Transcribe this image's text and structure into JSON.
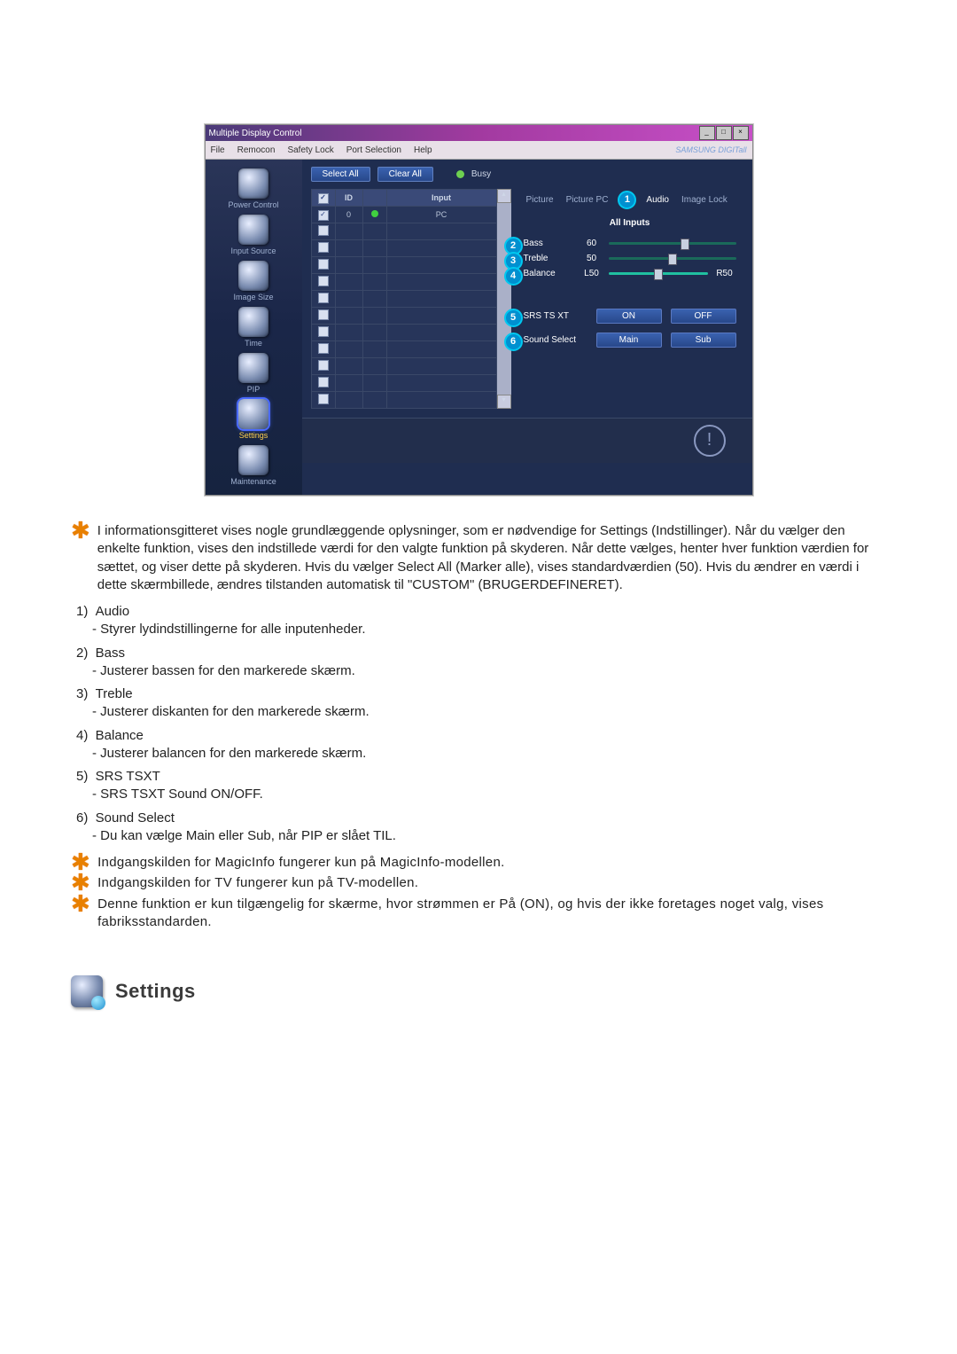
{
  "app": {
    "title": "Multiple Display Control",
    "menus": [
      "File",
      "Remocon",
      "Safety Lock",
      "Port Selection",
      "Help"
    ],
    "brand": "SAMSUNG DIGITall"
  },
  "sidebar": [
    {
      "label": "Power Control"
    },
    {
      "label": "Input Source"
    },
    {
      "label": "Image Size"
    },
    {
      "label": "Time"
    },
    {
      "label": "PIP"
    },
    {
      "label": "Settings",
      "selected": true
    },
    {
      "label": "Maintenance"
    }
  ],
  "toolbar": {
    "selectAll": "Select All",
    "clearAll": "Clear All",
    "busy": "Busy"
  },
  "grid": {
    "headers": [
      "",
      "ID",
      "",
      "Input"
    ],
    "rows": [
      {
        "checked": true,
        "id": "0",
        "status": true,
        "input": "PC"
      },
      {
        "checked": false
      },
      {
        "checked": false
      },
      {
        "checked": false
      },
      {
        "checked": false
      },
      {
        "checked": false
      },
      {
        "checked": false
      },
      {
        "checked": false
      },
      {
        "checked": false
      },
      {
        "checked": false
      },
      {
        "checked": false
      },
      {
        "checked": false
      }
    ]
  },
  "tabs": [
    "Picture",
    "Picture PC",
    "Audio",
    "Image Lock"
  ],
  "tabs_active": 2,
  "panel": {
    "subheader": "All Inputs",
    "bass": {
      "label": "Bass",
      "value": "60",
      "pct": 60
    },
    "treble": {
      "label": "Treble",
      "value": "50",
      "pct": 50
    },
    "balance": {
      "label": "Balance",
      "left": "L50",
      "right": "R50",
      "pct": 50
    },
    "srs": {
      "label": "SRS TS XT",
      "on": "ON",
      "off": "OFF"
    },
    "sound": {
      "label": "Sound Select",
      "main": "Main",
      "sub": "Sub"
    }
  },
  "doc": {
    "para1": "I informationsgitteret vises nogle grundlæggende oplysninger, som er nødvendige for Settings (Indstillinger). Når du vælger den enkelte funktion, vises den indstillede værdi for den valgte funktion på skyderen. Når dette vælges, henter hver funktion værdien for sættet, og viser dette på skyderen. Hvis du vælger Select All (Marker alle), vises standardværdien (50). Hvis du ændrer en værdi i dette skærmbillede, ændres tilstanden automatisk til \"CUSTOM\" (BRUGERDEFINERET).",
    "items": [
      {
        "t": "Audio",
        "d": "- Styrer lydindstillingerne for alle inputenheder."
      },
      {
        "t": "Bass",
        "d": "- Justerer bassen for den markerede skærm."
      },
      {
        "t": "Treble",
        "d": "- Justerer diskanten for den markerede skærm."
      },
      {
        "t": "Balance",
        "d": "- Justerer balancen for den markerede skærm."
      },
      {
        "t": "SRS TSXT",
        "d": "- SRS TSXT Sound ON/OFF."
      },
      {
        "t": "Sound Select",
        "d": "- Du kan vælge Main eller Sub, når PIP er slået TIL."
      }
    ],
    "note1": "Indgangskilden for MagicInfo fungerer kun på MagicInfo-modellen.",
    "note2": "Indgangskilden for TV fungerer kun på TV-modellen.",
    "note3": "Denne funktion er kun tilgængelig for skærme, hvor strømmen er På (ON), og hvis der ikke foretages noget valg, vises fabriksstandarden.",
    "heading": "Settings"
  }
}
